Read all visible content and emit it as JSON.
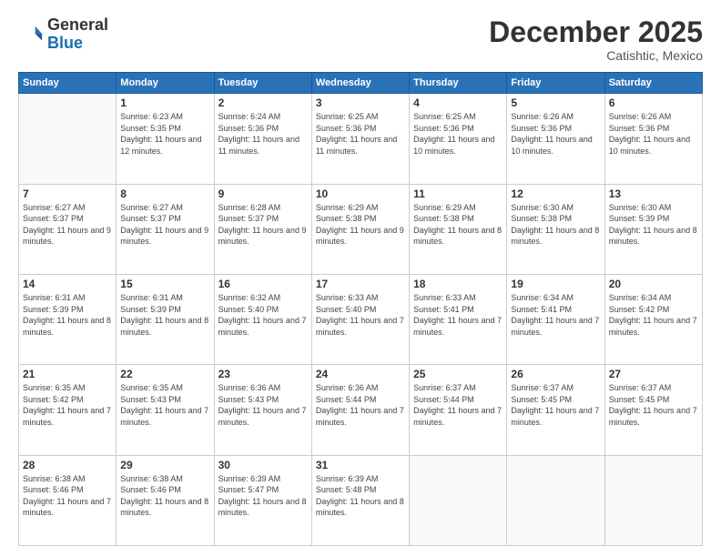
{
  "header": {
    "logo_general": "General",
    "logo_blue": "Blue",
    "month_title": "December 2025",
    "location": "Catishtic, Mexico"
  },
  "days_of_week": [
    "Sunday",
    "Monday",
    "Tuesday",
    "Wednesday",
    "Thursday",
    "Friday",
    "Saturday"
  ],
  "weeks": [
    [
      {
        "day": "",
        "sunrise": "",
        "sunset": "",
        "daylight": ""
      },
      {
        "day": "1",
        "sunrise": "6:23 AM",
        "sunset": "5:35 PM",
        "daylight": "11 hours and 12 minutes."
      },
      {
        "day": "2",
        "sunrise": "6:24 AM",
        "sunset": "5:36 PM",
        "daylight": "11 hours and 11 minutes."
      },
      {
        "day": "3",
        "sunrise": "6:25 AM",
        "sunset": "5:36 PM",
        "daylight": "11 hours and 11 minutes."
      },
      {
        "day": "4",
        "sunrise": "6:25 AM",
        "sunset": "5:36 PM",
        "daylight": "11 hours and 10 minutes."
      },
      {
        "day": "5",
        "sunrise": "6:26 AM",
        "sunset": "5:36 PM",
        "daylight": "11 hours and 10 minutes."
      },
      {
        "day": "6",
        "sunrise": "6:26 AM",
        "sunset": "5:36 PM",
        "daylight": "11 hours and 10 minutes."
      }
    ],
    [
      {
        "day": "7",
        "sunrise": "6:27 AM",
        "sunset": "5:37 PM",
        "daylight": "11 hours and 9 minutes."
      },
      {
        "day": "8",
        "sunrise": "6:27 AM",
        "sunset": "5:37 PM",
        "daylight": "11 hours and 9 minutes."
      },
      {
        "day": "9",
        "sunrise": "6:28 AM",
        "sunset": "5:37 PM",
        "daylight": "11 hours and 9 minutes."
      },
      {
        "day": "10",
        "sunrise": "6:29 AM",
        "sunset": "5:38 PM",
        "daylight": "11 hours and 9 minutes."
      },
      {
        "day": "11",
        "sunrise": "6:29 AM",
        "sunset": "5:38 PM",
        "daylight": "11 hours and 8 minutes."
      },
      {
        "day": "12",
        "sunrise": "6:30 AM",
        "sunset": "5:38 PM",
        "daylight": "11 hours and 8 minutes."
      },
      {
        "day": "13",
        "sunrise": "6:30 AM",
        "sunset": "5:39 PM",
        "daylight": "11 hours and 8 minutes."
      }
    ],
    [
      {
        "day": "14",
        "sunrise": "6:31 AM",
        "sunset": "5:39 PM",
        "daylight": "11 hours and 8 minutes."
      },
      {
        "day": "15",
        "sunrise": "6:31 AM",
        "sunset": "5:39 PM",
        "daylight": "11 hours and 8 minutes."
      },
      {
        "day": "16",
        "sunrise": "6:32 AM",
        "sunset": "5:40 PM",
        "daylight": "11 hours and 7 minutes."
      },
      {
        "day": "17",
        "sunrise": "6:33 AM",
        "sunset": "5:40 PM",
        "daylight": "11 hours and 7 minutes."
      },
      {
        "day": "18",
        "sunrise": "6:33 AM",
        "sunset": "5:41 PM",
        "daylight": "11 hours and 7 minutes."
      },
      {
        "day": "19",
        "sunrise": "6:34 AM",
        "sunset": "5:41 PM",
        "daylight": "11 hours and 7 minutes."
      },
      {
        "day": "20",
        "sunrise": "6:34 AM",
        "sunset": "5:42 PM",
        "daylight": "11 hours and 7 minutes."
      }
    ],
    [
      {
        "day": "21",
        "sunrise": "6:35 AM",
        "sunset": "5:42 PM",
        "daylight": "11 hours and 7 minutes."
      },
      {
        "day": "22",
        "sunrise": "6:35 AM",
        "sunset": "5:43 PM",
        "daylight": "11 hours and 7 minutes."
      },
      {
        "day": "23",
        "sunrise": "6:36 AM",
        "sunset": "5:43 PM",
        "daylight": "11 hours and 7 minutes."
      },
      {
        "day": "24",
        "sunrise": "6:36 AM",
        "sunset": "5:44 PM",
        "daylight": "11 hours and 7 minutes."
      },
      {
        "day": "25",
        "sunrise": "6:37 AM",
        "sunset": "5:44 PM",
        "daylight": "11 hours and 7 minutes."
      },
      {
        "day": "26",
        "sunrise": "6:37 AM",
        "sunset": "5:45 PM",
        "daylight": "11 hours and 7 minutes."
      },
      {
        "day": "27",
        "sunrise": "6:37 AM",
        "sunset": "5:45 PM",
        "daylight": "11 hours and 7 minutes."
      }
    ],
    [
      {
        "day": "28",
        "sunrise": "6:38 AM",
        "sunset": "5:46 PM",
        "daylight": "11 hours and 7 minutes."
      },
      {
        "day": "29",
        "sunrise": "6:38 AM",
        "sunset": "5:46 PM",
        "daylight": "11 hours and 8 minutes."
      },
      {
        "day": "30",
        "sunrise": "6:39 AM",
        "sunset": "5:47 PM",
        "daylight": "11 hours and 8 minutes."
      },
      {
        "day": "31",
        "sunrise": "6:39 AM",
        "sunset": "5:48 PM",
        "daylight": "11 hours and 8 minutes."
      },
      {
        "day": "",
        "sunrise": "",
        "sunset": "",
        "daylight": ""
      },
      {
        "day": "",
        "sunrise": "",
        "sunset": "",
        "daylight": ""
      },
      {
        "day": "",
        "sunrise": "",
        "sunset": "",
        "daylight": ""
      }
    ]
  ]
}
